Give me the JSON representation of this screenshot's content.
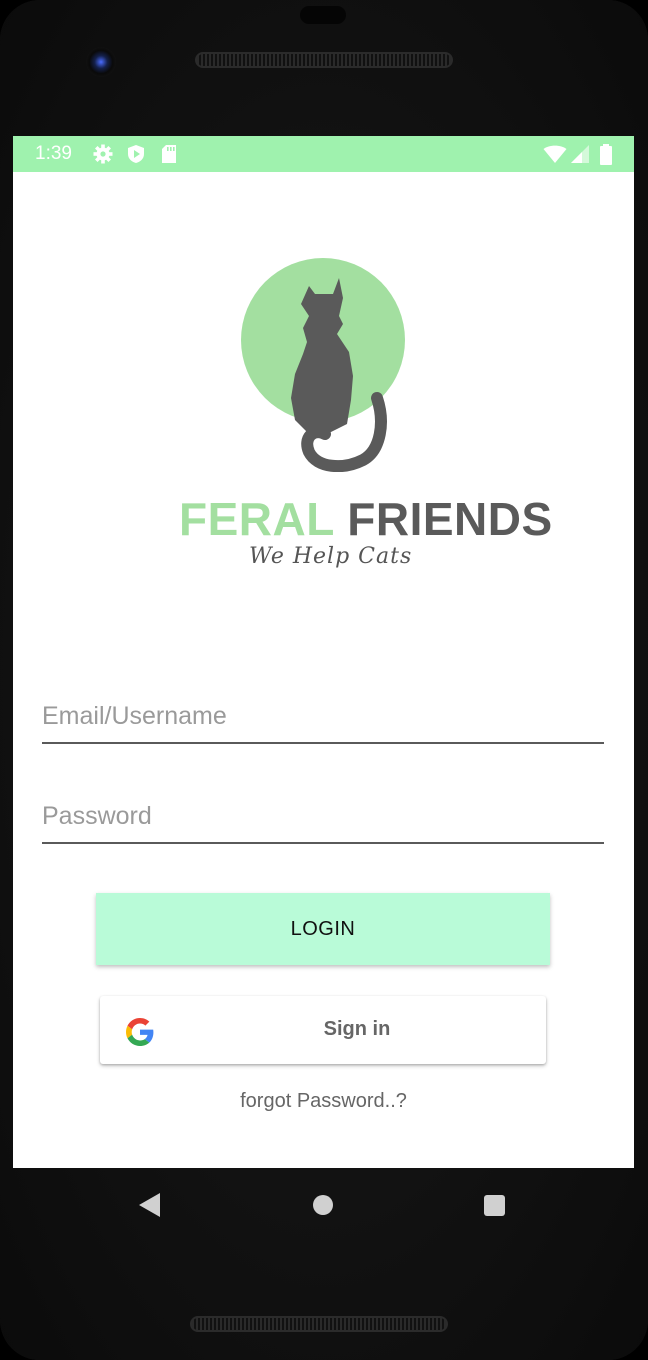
{
  "status_bar": {
    "time": "1:39",
    "icons": [
      "gear-icon",
      "play-protect-icon",
      "sd-card-icon",
      "wifi-icon",
      "signal-icon",
      "battery-icon"
    ],
    "background_color": "#9ff2ae"
  },
  "logo": {
    "brand_part1": "FERAL",
    "brand_part2": "FRIENDS",
    "tagline": "We Help Cats",
    "circle_color": "#a3dfa0",
    "cat_color": "#5a5a5a"
  },
  "form": {
    "email_placeholder": "Email/Username",
    "password_placeholder": "Password",
    "email_value": "",
    "password_value": ""
  },
  "buttons": {
    "login_label": "LOGIN",
    "login_color": "#b9fbd8",
    "google_label": "Sign in",
    "forgot_label": "forgot Password..?"
  },
  "nav_bar": {
    "icons": [
      "back-icon",
      "home-icon",
      "recents-icon"
    ]
  }
}
